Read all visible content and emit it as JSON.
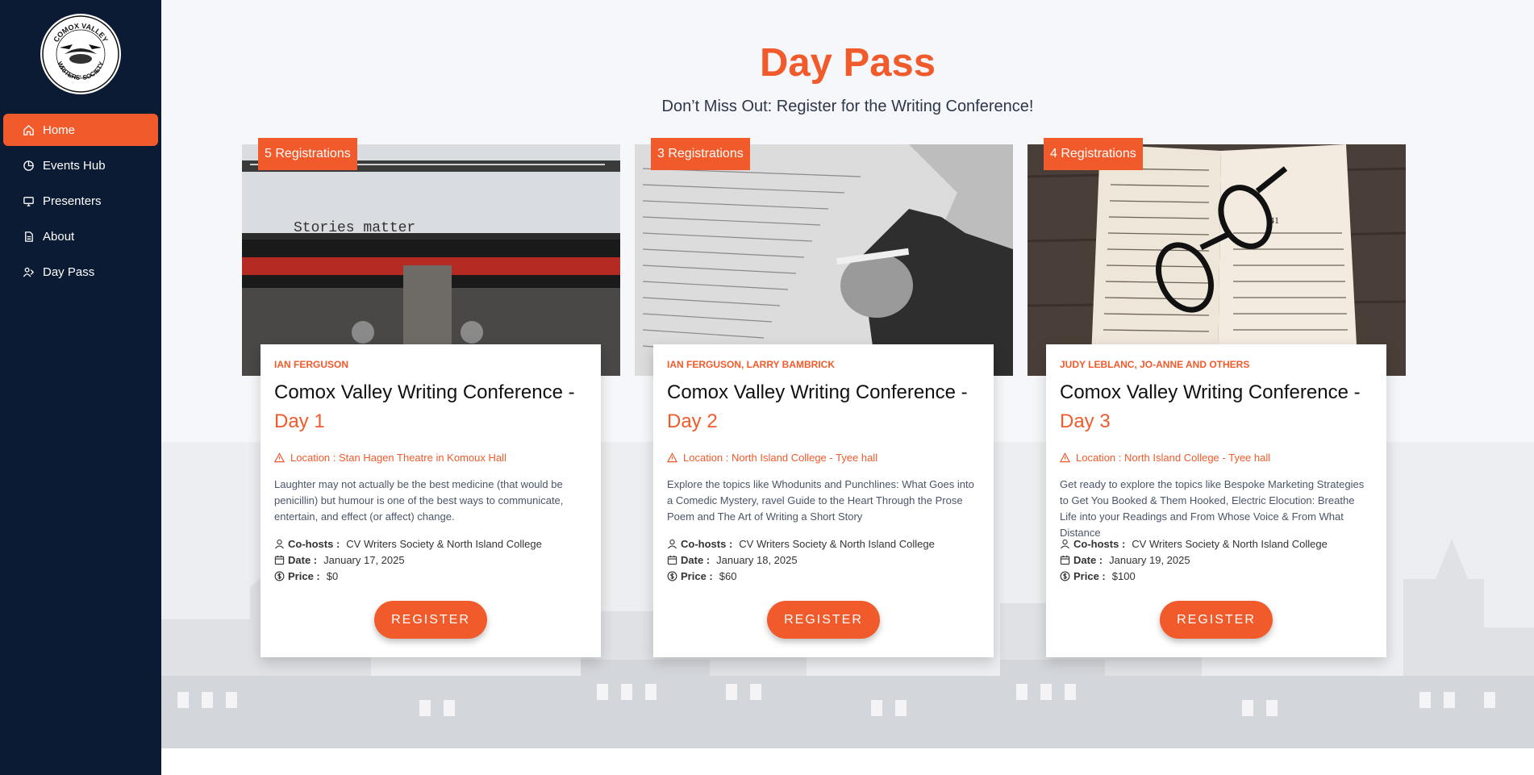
{
  "sidebar": {
    "logo_text": [
      "COMOX VALLEY",
      "WRITERS' SOCIETY"
    ],
    "items": [
      {
        "label": "Home",
        "icon": "home-icon",
        "active": true
      },
      {
        "label": "Events Hub",
        "icon": "pie-chart-icon"
      },
      {
        "label": "Presenters",
        "icon": "monitor-icon"
      },
      {
        "label": "About",
        "icon": "document-icon"
      },
      {
        "label": "Day Pass",
        "icon": "users-icon"
      }
    ]
  },
  "header": {
    "title": "Day Pass",
    "subtitle": "Don’t Miss Out: Register for the Writing Conference!"
  },
  "cards": [
    {
      "registrations": "5 Registrations",
      "presenters": "Ian Ferguson",
      "title_prefix": "Comox Valley Writing Conference -",
      "title_day": "Day 1",
      "location": "Location : Stan Hagen Theatre in Komoux Hall",
      "description": "Laughter may not actually be the best medicine (that would be penicillin) but humour is one of the best ways to communicate, entertain, and effect (or affect) change.",
      "cohosts_label": "Co-hosts :",
      "cohosts": "CV Writers Society & North Island College",
      "date_label": "Date :",
      "date": "January 17, 2025",
      "price_label": "Price :",
      "price": "$0",
      "button": "REGISTER",
      "image": "typewriter-image",
      "image_text": "Stories matter"
    },
    {
      "registrations": "3 Registrations",
      "presenters": "Ian Ferguson, Larry Bambrick",
      "title_prefix": "Comox Valley Writing Conference -",
      "title_day": "Day 2",
      "location": "Location : North Island College - Tyee hall",
      "description": "Explore the topics like Whodunits and Punchlines: What Goes into a Comedic Mystery, ravel Guide to the Heart Through the Prose Poem and The Art of Writing a Short Story",
      "cohosts_label": "Co-hosts :",
      "cohosts": "CV Writers Society & North Island College",
      "date_label": "Date :",
      "date": "January 18, 2025",
      "price_label": "Price :",
      "price": "$60",
      "button": "REGISTER",
      "image": "hand-writing-image"
    },
    {
      "registrations": "4 Registrations",
      "presenters": "Judy LeBlanc, Jo-Anne and others",
      "title_prefix": "Comox Valley Writing Conference -",
      "title_day": "Day 3",
      "location": "Location : North Island College - Tyee hall",
      "description": "Get ready to explore the topics like Bespoke Marketing Strategies to Get You Booked & Them Hooked, Electric Elocution: Breathe Life into your Readings and From Whose Voice & From What Distance",
      "cohosts_label": "Co-hosts :",
      "cohosts": "CV Writers Society & North Island College",
      "date_label": "Date :",
      "date": "January 19, 2025",
      "price_label": "Price :",
      "price": "$100",
      "button": "REGISTER",
      "image": "book-glasses-image",
      "image_text": "41"
    }
  ],
  "colors": {
    "accent": "#f15a2b",
    "sidebar": "#0b1b33",
    "background": "#f5f7fa"
  }
}
